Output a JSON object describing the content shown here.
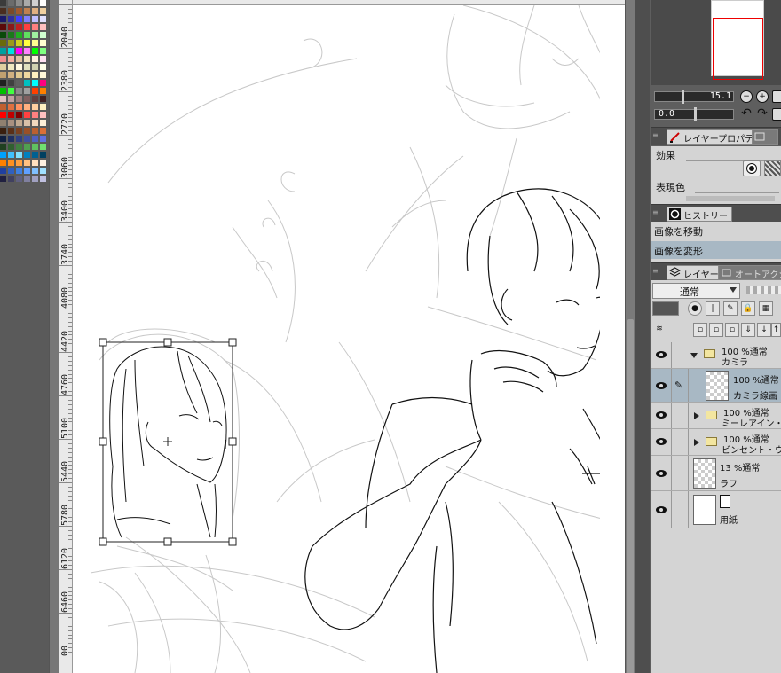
{
  "palette": {
    "colors": [
      "#3b3b3b",
      "#6b6b6b",
      "#8a8a8a",
      "#aaaaaa",
      "#d0d0d0",
      "#ffffff",
      "#4a2e20",
      "#7a4a2a",
      "#a05a30",
      "#c08050",
      "#e0b080",
      "#f0d0a0",
      "#1a1a6a",
      "#3030a0",
      "#4040ff",
      "#8080ff",
      "#c0c0ff",
      "#e0e0ff",
      "#5a0a0a",
      "#8a1a1a",
      "#c02020",
      "#ff4040",
      "#ff8080",
      "#ffc0c0",
      "#0a4a0a",
      "#1a7a1a",
      "#20b020",
      "#60e060",
      "#a0f0a0",
      "#d0ffd0",
      "#6a6a0a",
      "#9a9a1a",
      "#d0d020",
      "#ffff40",
      "#ffff90",
      "#ffffd0",
      "#00a0a0",
      "#00e0e0",
      "#ff00ff",
      "#ff80ff",
      "#00ff00",
      "#80ff80",
      "#f09090",
      "#f0b0a0",
      "#e0c0a0",
      "#f0e0c0",
      "#fff0e0",
      "#ffe0f0",
      "#e0d0a0",
      "#f0e8c0",
      "#fff8e0",
      "#e0e0c0",
      "#d0d0b0",
      "#ffffe8",
      "#c0a070",
      "#d0b080",
      "#e0c890",
      "#f0d8a0",
      "#fff0c0",
      "#fff8d8",
      "#202020",
      "#404040",
      "#606060",
      "#00c0c0",
      "#00ffff",
      "#ff0080",
      "#00c000",
      "#40ff40",
      "#8a8a8a",
      "#a0a0a0",
      "#ff4000",
      "#ff8000",
      "#e0c0c0",
      "#c0a0a0",
      "#a08080",
      "#806060",
      "#604040",
      "#402020",
      "#c06030",
      "#e07040",
      "#ff9060",
      "#ffb080",
      "#ffd0a0",
      "#fff0c0",
      "#ff0000",
      "#c00000",
      "#800000",
      "#ff4040",
      "#ff8080",
      "#ffc0c0",
      "#908070",
      "#a89080",
      "#c0a890",
      "#d8c0a8",
      "#f0d8c0",
      "#fff0d8",
      "#3a2010",
      "#5a3018",
      "#7a4020",
      "#9a5028",
      "#ba6030",
      "#da7038",
      "#102040",
      "#203060",
      "#304080",
      "#4050a0",
      "#5060c0",
      "#6070e0",
      "#204020",
      "#306030",
      "#408040",
      "#50a050",
      "#60c060",
      "#70e070",
      "#00a0ff",
      "#40c0ff",
      "#80e0ff",
      "#0080c0",
      "#006090",
      "#004060",
      "#ff8000",
      "#ff9020",
      "#ffa040",
      "#ffc080",
      "#ffe0c0",
      "#fff0e0",
      "#2040a0",
      "#3060c0",
      "#4080e0",
      "#60a0ff",
      "#80c0ff",
      "#a0e0ff",
      "#202040",
      "#404060",
      "#606080",
      "#8080a0",
      "#a0a0c0",
      "#c0c0e0"
    ]
  },
  "ruler": {
    "labels": [
      "2040",
      "2380",
      "2720",
      "3060",
      "3400",
      "3740",
      "4080",
      "4420",
      "4760",
      "5100",
      "5440",
      "5780",
      "6120",
      "6460",
      "00"
    ]
  },
  "navigator": {
    "zoom_value": "15.1",
    "rotate_value": "0.0"
  },
  "layer_property_panel": {
    "tab_label": "レイヤープロパティ",
    "effect_label": "効果",
    "display_color_label": "表現色"
  },
  "history_panel": {
    "tab_label": "ヒストリー",
    "items": [
      "画像を移動",
      "画像を変形"
    ]
  },
  "layer_panel": {
    "tab_label": "レイヤー",
    "tab2_label": "オートアクシ",
    "blend_mode": "通常",
    "layers": [
      {
        "top": "100 %通常",
        "name": "カミラ",
        "type": "folder",
        "open": true
      },
      {
        "top": "100 %通常",
        "name": "カミラ線画",
        "type": "raster",
        "selected": true
      },
      {
        "top": "100 %通常",
        "name": "ミーレアイン・キ",
        "type": "folder"
      },
      {
        "top": "100 %通常",
        "name": "ビンセント・ウォ",
        "type": "folder"
      },
      {
        "top": "13 %通常",
        "name": "ラフ",
        "type": "raster"
      },
      {
        "top": "",
        "name": "用紙",
        "type": "paper"
      }
    ]
  },
  "colors": {
    "selection": "#a8b8c4",
    "panel_bg": "#d4d4d4",
    "app_bg": "#6b6b6b",
    "nav_frame": "#e00000"
  }
}
